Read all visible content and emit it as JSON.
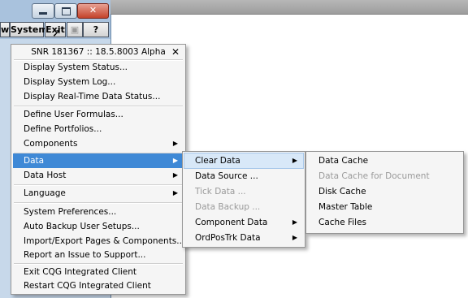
{
  "toolbar": {
    "w_label": "w",
    "system_label": "System",
    "exit_label": "Exit",
    "help_label": "?"
  },
  "main_menu": {
    "header": "SNR 181367 :: 18.5.8003 Alpha",
    "close_glyph": "✕",
    "items": [
      {
        "label": "Display System Status...",
        "submenu": false
      },
      {
        "label": "Display System Log...",
        "submenu": false
      },
      {
        "label": "Display Real-Time Data Status...",
        "submenu": false
      },
      {
        "label": "Define User Formulas...",
        "submenu": false
      },
      {
        "label": "Define Portfolios...",
        "submenu": false
      },
      {
        "label": "Components",
        "submenu": true
      },
      {
        "label": "Data",
        "submenu": true,
        "selected": true
      },
      {
        "label": "Data Host",
        "submenu": true
      },
      {
        "label": "Language",
        "submenu": true
      },
      {
        "label": "System Preferences...",
        "submenu": false
      },
      {
        "label": "Auto Backup User Setups...",
        "submenu": false
      },
      {
        "label": "Import/Export Pages & Components...",
        "submenu": false
      },
      {
        "label": "Report an Issue to Support...",
        "submenu": false
      },
      {
        "label": "Exit CQG Integrated Client",
        "submenu": false
      },
      {
        "label": "Restart CQG Integrated Client",
        "submenu": false
      }
    ]
  },
  "data_menu": {
    "items": [
      {
        "label": "Clear Data",
        "submenu": true,
        "highlighted": true
      },
      {
        "label": "Data Source ...",
        "submenu": false
      },
      {
        "label": "Tick Data ...",
        "submenu": false,
        "disabled": true
      },
      {
        "label": "Data Backup ...",
        "submenu": false,
        "disabled": true
      },
      {
        "label": "Component Data",
        "submenu": true
      },
      {
        "label": "OrdPosTrk Data",
        "submenu": true
      }
    ]
  },
  "clear_menu": {
    "items": [
      {
        "label": "Data Cache"
      },
      {
        "label": "Data Cache for Document",
        "disabled": true
      },
      {
        "label": "Disk Cache"
      },
      {
        "label": "Master Table"
      },
      {
        "label": "Cache Files"
      }
    ]
  },
  "arrow_glyph": "▶"
}
